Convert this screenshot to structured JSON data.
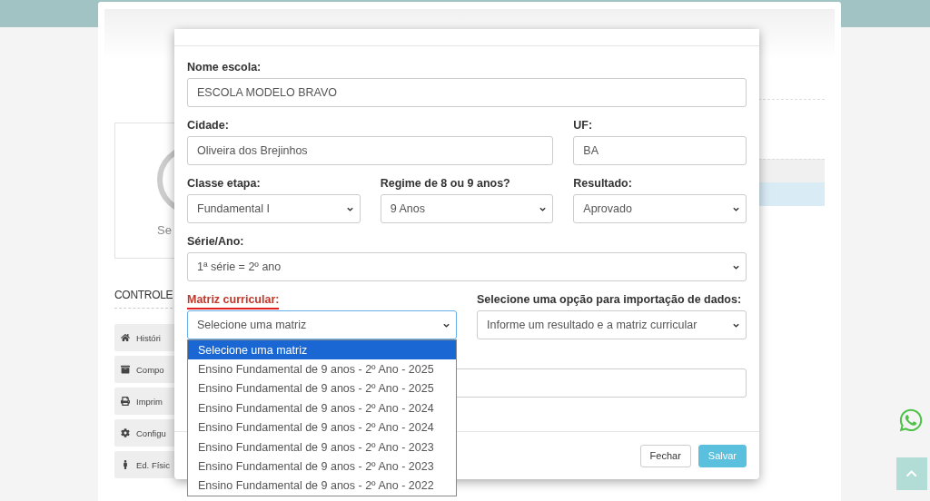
{
  "page": {
    "profile_caption": "Se",
    "section_title": "CONTROLE",
    "menu": [
      {
        "label": "Históri"
      },
      {
        "label": "Compo"
      },
      {
        "label": "Imprim"
      },
      {
        "label": "Configu"
      },
      {
        "label": "Ed. Físic"
      }
    ]
  },
  "modal": {
    "fields": [
      {
        "kind": "input",
        "label": "Nome escola:",
        "value": "ESCOLA MODELO BRAVO"
      },
      {
        "kind": "input",
        "label": "Cidade:",
        "value": "Oliveira dos Brejinhos"
      },
      {
        "kind": "input",
        "label": "UF:",
        "value": "BA"
      },
      {
        "kind": "select",
        "label": "Classe etapa:",
        "value": "Fundamental I"
      },
      {
        "kind": "select",
        "label": "Regime de 8 ou 9 anos?",
        "value": "9 Anos"
      },
      {
        "kind": "select",
        "label": "Resultado:",
        "value": "Aprovado"
      },
      {
        "kind": "select",
        "label": "Série/Ano:",
        "value": "1ª série = 2º ano"
      },
      {
        "kind": "select",
        "label": "Matriz curricular:",
        "value": "Selecione uma matriz",
        "highlighted": true,
        "open": true,
        "focused": true,
        "options": [
          {
            "label": "Selecione uma matriz",
            "selected": true
          },
          {
            "label": "Ensino Fundamental de 9 anos - 2º Ano - 2025",
            "selected": false
          },
          {
            "label": "Ensino Fundamental de 9 anos - 2º Ano - 2025",
            "selected": false
          },
          {
            "label": "Ensino Fundamental de 9 anos - 2º Ano - 2024",
            "selected": false
          },
          {
            "label": "Ensino Fundamental de 9 anos - 2º Ano - 2024",
            "selected": false
          },
          {
            "label": "Ensino Fundamental de 9 anos - 2º Ano - 2023",
            "selected": false
          },
          {
            "label": "Ensino Fundamental de 9 anos - 2º Ano - 2023",
            "selected": false
          },
          {
            "label": "Ensino Fundamental de 9 anos - 2º Ano - 2022",
            "selected": false
          }
        ]
      },
      {
        "kind": "select",
        "label": "Selecione uma opção para importação de dados:",
        "value": "Informe um resultado e a matriz curricular"
      },
      {
        "kind": "input"
      }
    ],
    "buttons": [
      {
        "label": "Fechar",
        "kind": "default"
      },
      {
        "label": "Salvar",
        "kind": "primary"
      }
    ]
  }
}
